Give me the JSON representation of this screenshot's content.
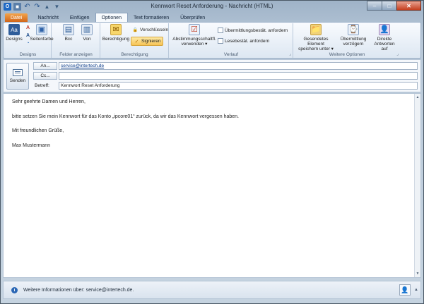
{
  "window": {
    "title": "Kennwort Reset Anforderung - Nachricht (HTML)",
    "minimize_glyph": "–",
    "maximize_glyph": "□",
    "close_glyph": "✕"
  },
  "quick_access": {
    "app_icon_glyph": "O",
    "save_glyph": "■",
    "undo_glyph": "↶",
    "redo_glyph": "↷",
    "up_glyph": "▲",
    "down_glyph": "▼"
  },
  "tabs": [
    "Datei",
    "Nachricht",
    "Einfügen",
    "Optionen",
    "Text formatieren",
    "Überprüfen"
  ],
  "ribbon": {
    "designs": {
      "designs_label": "Designs",
      "seitenfarbe_label": "Seitenfarbe",
      "group_label": "Designs"
    },
    "felder": {
      "bcc_label": "Bcc",
      "von_label": "Von",
      "group_label": "Felder anzeigen"
    },
    "berechtigung": {
      "berechtigung_label": "Berechtigung",
      "verschluesseln_label": "Verschlüsseln",
      "signieren_label": "Signieren",
      "group_label": "Berechtigung"
    },
    "verlauf": {
      "abstimmung_line1": "Abstimmungsschaltfl.",
      "abstimmung_line2": "verwenden ▾",
      "uebermittlung_label": "Übermittlungsbestät. anfordern",
      "lesebestaetigung_label": "Lesebestät. anfordern",
      "group_label": "Verlauf"
    },
    "weitere": {
      "gesendetes_line1": "Gesendetes Element",
      "gesendetes_line2": "speichern unter ▾",
      "verzoegern_line1": "Übermittlung",
      "verzoegern_line2": "verzögern",
      "direkte_line1": "Direkte",
      "direkte_line2": "Antworten auf",
      "group_label": "Weitere Optionen"
    },
    "launcher_glyph": "⌟"
  },
  "icons": {
    "designs": "Aa",
    "seitenfarbe": "▣",
    "bcc": "▤",
    "von": "▥",
    "berechtigung": "✉",
    "lock": "🔒",
    "sign": "✓",
    "abstimmung": "☑",
    "gesendetes": "📁",
    "verzoegern": "⌚",
    "direkte": "👤",
    "small_colors": "A",
    "small_fonts": "A",
    "small_effects": "◔"
  },
  "compose": {
    "send_label": "Senden",
    "to_button": "An...",
    "cc_button": "Cc...",
    "subject_label": "Betreff:",
    "to_value": "service@intertech.de",
    "cc_value": "",
    "subject_value": "Kennwort Reset Anforderung"
  },
  "message": {
    "greeting": "Sehr geehrte Damen und Herren,",
    "text": "bitte setzen Sie mein Kennwort für das Konto „ipcore01“ zurück, da wir das Kennwort vergessen haben.",
    "closing": "Mit freundlichen Grüße,",
    "signature": "Max Mustermann"
  },
  "scrollbar": {
    "up_glyph": "▲",
    "down_glyph": "▼"
  },
  "infobar": {
    "icon_glyph": "i",
    "text": "Weitere Informationen über: service@intertech.de.",
    "person_glyph": "👤",
    "expand_glyph": "▲"
  }
}
